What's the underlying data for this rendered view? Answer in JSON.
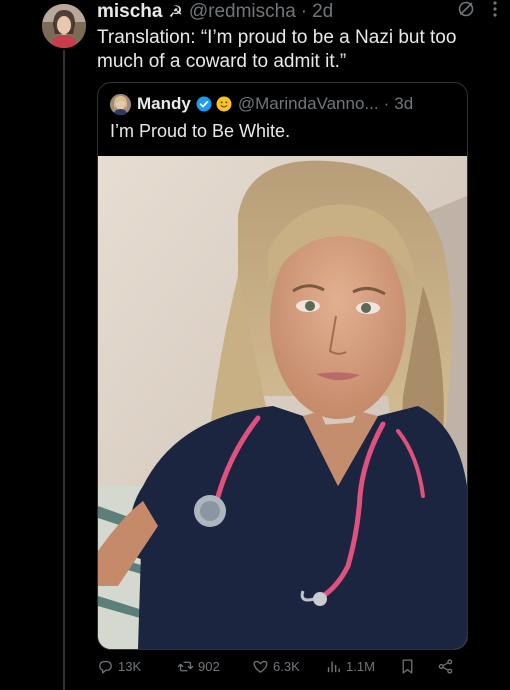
{
  "tweet": {
    "author_name": "mischa",
    "author_icon": "hammer-sickle-icon",
    "handle": "@redmischa",
    "separator": "·",
    "time": "2d",
    "text": "Translation: “I’m proud to be a Nazi but too much of a coward to admit it.”"
  },
  "quote": {
    "author_name": "Mandy",
    "handle": "@MarindaVanno...",
    "separator": "·",
    "time": "3d",
    "text": "I’m Proud to Be White.",
    "verified_color": "#1d9bf0",
    "photo_alt": "Selfie of a woman in navy scrubs with a pink stethoscope"
  },
  "actions": {
    "replies": "13K",
    "reposts": "902",
    "likes": "6.3K",
    "views": "1.1M"
  },
  "colors": {
    "background": "#000000",
    "text": "#e7e9ea",
    "muted": "#71767b",
    "border": "#2f3336"
  }
}
